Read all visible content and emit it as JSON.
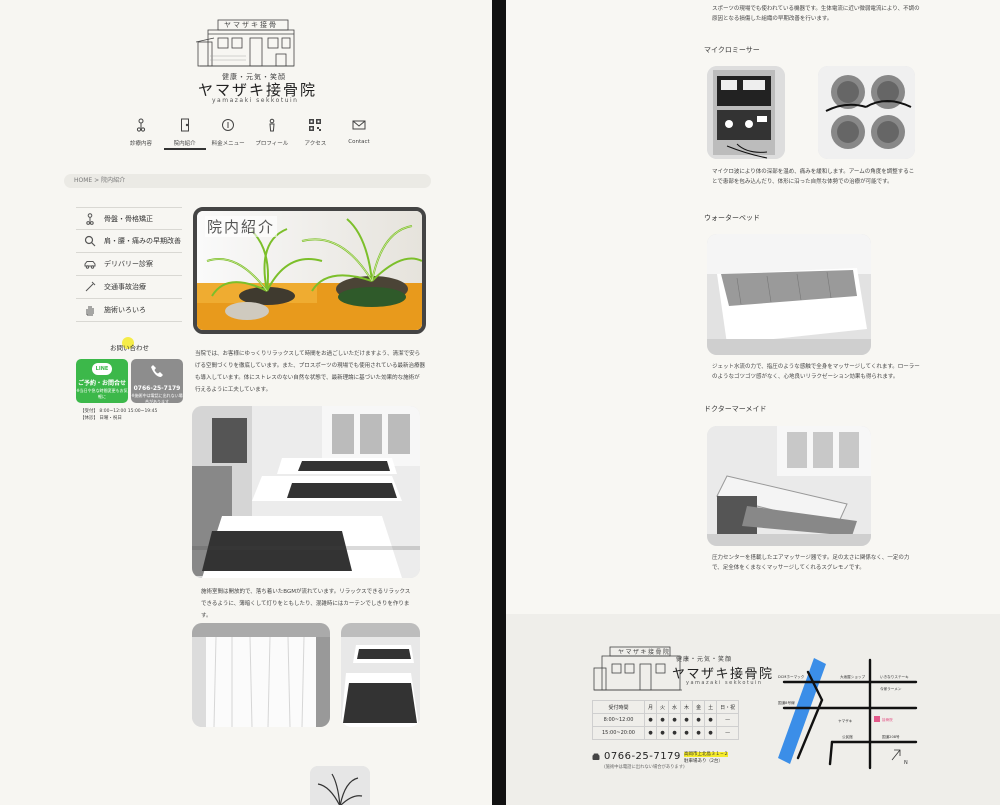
{
  "site": {
    "tagline": "健康・元気・笑顔",
    "name": "ヤマザキ接骨院",
    "roman": "yamazaki sekkotuin",
    "sign": "ヤマザキ接骨院"
  },
  "nav": [
    {
      "label": "診療内容",
      "icon": "bone-icon"
    },
    {
      "label": "院内紹介",
      "icon": "door-icon",
      "active": true
    },
    {
      "label": "料金メニュー",
      "icon": "coin-icon"
    },
    {
      "label": "プロフィール",
      "icon": "person-icon"
    },
    {
      "label": "アクセス",
      "icon": "qr-icon"
    },
    {
      "label": "Contact",
      "icon": "mail-icon"
    }
  ],
  "breadcrumb": {
    "home": "HOME",
    "separator": ">",
    "current": "院内紹介"
  },
  "sidebar": [
    {
      "label": "骨盤・骨格矯正",
      "icon": "bone-icon"
    },
    {
      "label": "肩・腰・痛みの早期改善",
      "icon": "magnifier-icon"
    },
    {
      "label": "デリバリー診察",
      "icon": "car-icon"
    },
    {
      "label": "交通事故治療",
      "icon": "needle-icon"
    },
    {
      "label": "施術いろいろ",
      "icon": "hand-icon"
    }
  ],
  "contact": {
    "title": "お問い合わせ",
    "line_badge": "LINE",
    "line_label": "ご予約・お問合せ",
    "line_sub": "※当日や急な時間変更もお気軽に",
    "tel_label": "0766-25-7179",
    "tel_sub": "※施術中は電話に出れない場合があります",
    "hours_line1": "【受付】 8:00~12:00 15:00~19:45",
    "hours_line2": "【休診】 日曜・祝日"
  },
  "hero": {
    "title": "院内紹介"
  },
  "intro": "当院では、お客様にゆっくりリラックスして時間をお過ごしいただけますよう、清潔で安らげる空間づくりを徹底しています。また、プロスポーツの現場でも使用されている最新治療器も導入しています。体にストレスのない自然な状態で、最新理論に基づいた効果的な施術が行えるように工夫しています。",
  "room_caption": "施術室間は開放的で、落ち着いたBGMが流れています。リラックスできるリラックスできるように、薄暗くして灯りをともしたり、混雑時にはカーテンでしきりを作ります。",
  "right": {
    "top_text": "スポーツの現場でも使われている機器です。生体電流に近い微弱電流により、不調の原因となる損傷した組織の早期改善を行います。",
    "micro_title": "マイクロミーサー",
    "micro_text": "マイクロ波により体の深部を温め、痛みを緩和します。アームの角度を調整することで患部を包み込んだり、体形に沿った自然な体勢での治療が可能です。",
    "water_title": "ウォーターベッド",
    "water_text": "ジェット水流の力で、指圧のような感触で全身をマッサージしてくれます。ローラーのようなゴツゴツ感がなく、心地良いリラクゼーション効果も得られます。",
    "doctor_title": "ドクターマーメイド",
    "doctor_text": "圧力センターを搭載したエアマッサージ器です。足の太さに関係なく、一定の力で、足全体をくまなくマッサージしてくれるスグレモノです。"
  },
  "footer": {
    "table_header": [
      "受付時間",
      "月",
      "火",
      "水",
      "木",
      "金",
      "土",
      "日・祝"
    ],
    "rows": [
      [
        "8:00~12:00",
        "●",
        "●",
        "●",
        "●",
        "●",
        "●",
        "—"
      ],
      [
        "15:00~20:00",
        "●",
        "●",
        "●",
        "●",
        "●",
        "●",
        "—"
      ]
    ],
    "tel": "0766-25-7179",
    "tel_note": "(施術中は電話に出れない場合があります)",
    "address_line1": "高岡市上北島３１−２",
    "address_line2": "駐車場あり（2台）",
    "map_labels": {
      "rd1": "DCMホーマック",
      "rd2": "大坂屋ショップ",
      "rd3": "いきなりステーキ",
      "rd4": "今家ラーメン",
      "rd5": "国道8号線",
      "rd6": "ヤマザキ",
      "rd7": "公民館",
      "rd8": "国道208号",
      "clinic": "接骨院"
    }
  },
  "colors": {
    "line_green": "#3cb84a",
    "tel_gray": "#8d8d8d",
    "highlight": "#f4ea2a",
    "river": "#3b8ee8",
    "clinic_pin": "#e35a8a"
  }
}
